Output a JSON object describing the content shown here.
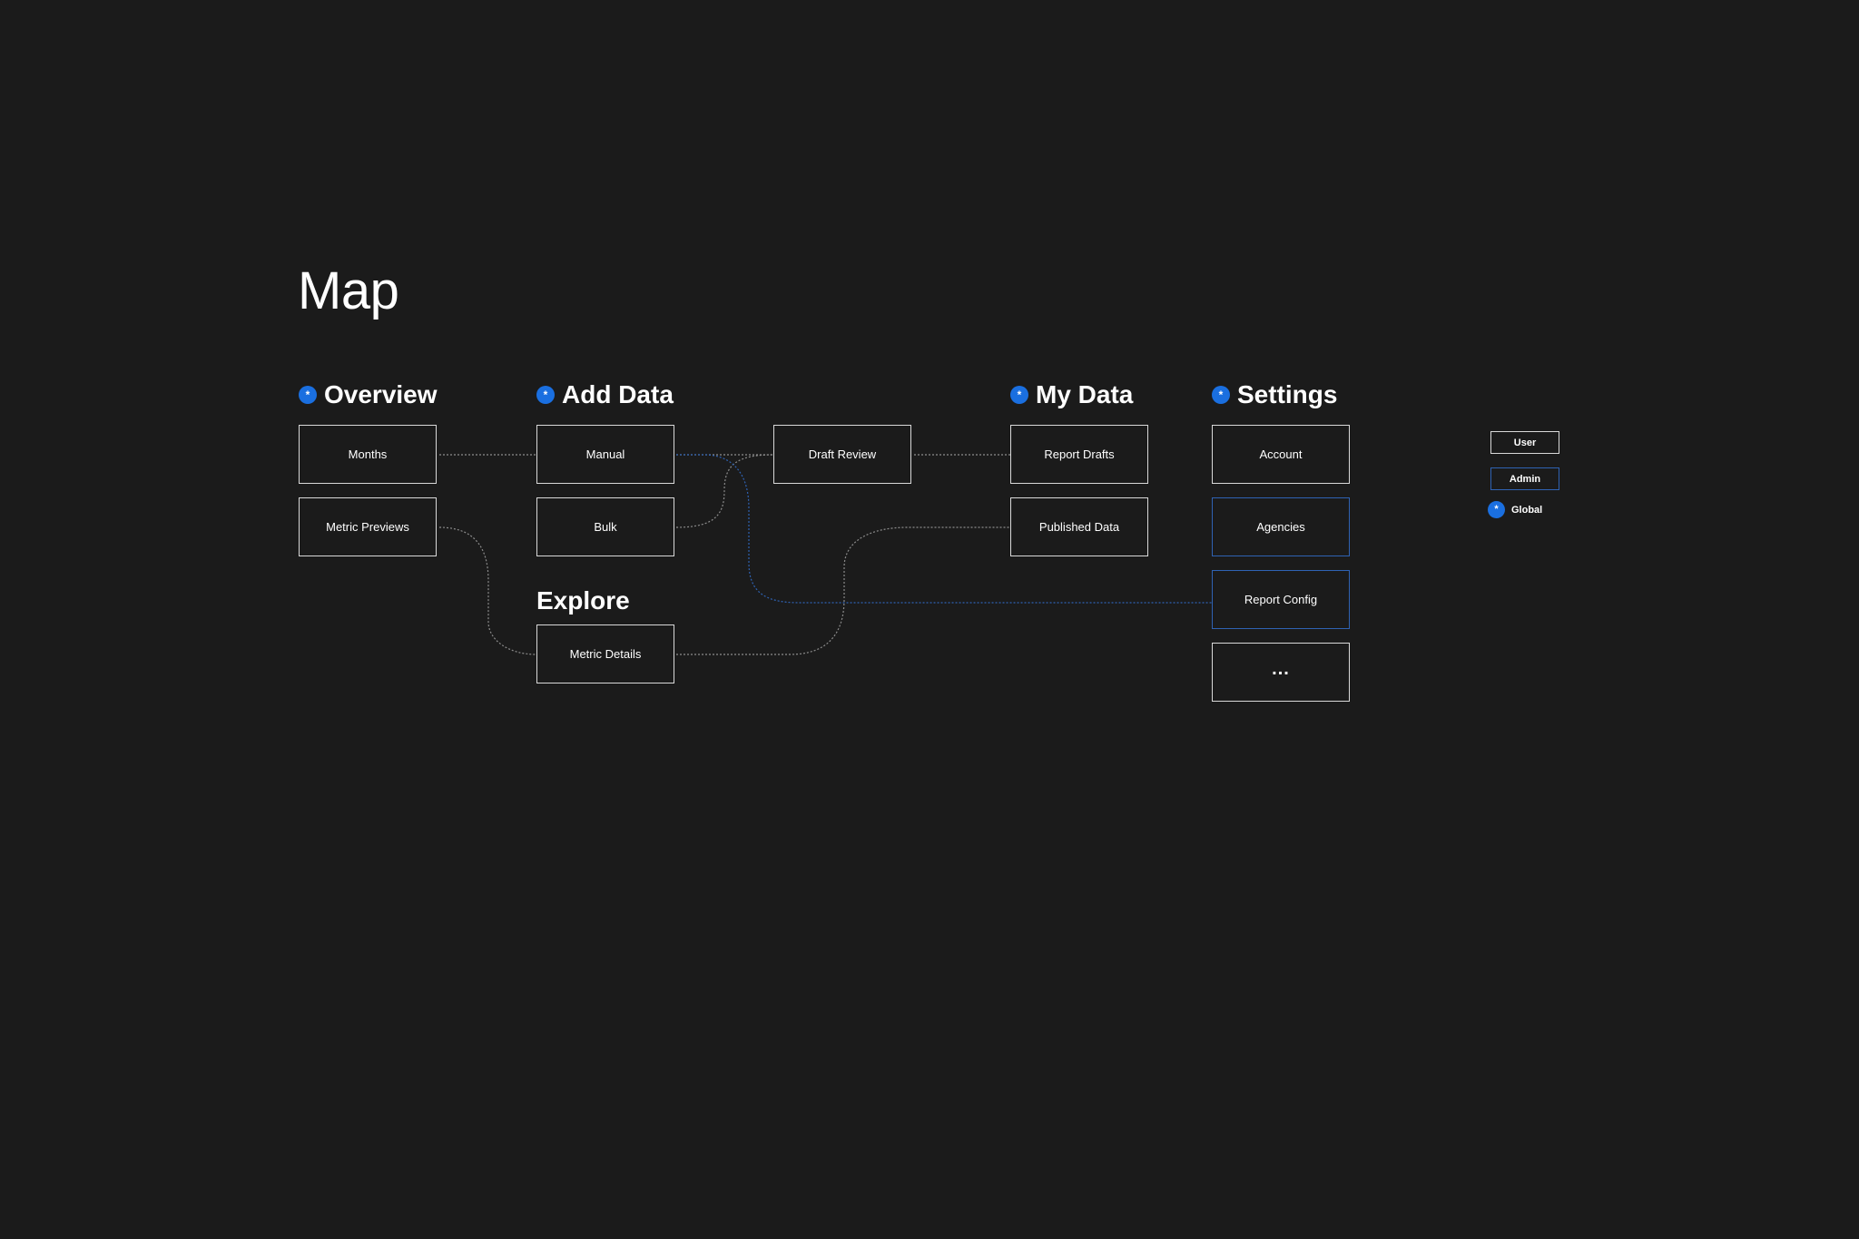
{
  "title": "Map",
  "global_marker": "*",
  "sections": {
    "overview": {
      "label": "Overview",
      "global": true
    },
    "add_data": {
      "label": "Add Data",
      "global": true
    },
    "my_data": {
      "label": "My Data",
      "global": true
    },
    "settings": {
      "label": "Settings",
      "global": true
    },
    "explore": {
      "label": "Explore",
      "global": false
    }
  },
  "nodes": {
    "months": {
      "label": "Months",
      "role": "user"
    },
    "metric_previews": {
      "label": "Metric Previews",
      "role": "user"
    },
    "manual": {
      "label": "Manual",
      "role": "user"
    },
    "bulk": {
      "label": "Bulk",
      "role": "user"
    },
    "metric_details": {
      "label": "Metric Details",
      "role": "user"
    },
    "draft_review": {
      "label": "Draft Review",
      "role": "user"
    },
    "report_drafts": {
      "label": "Report Drafts",
      "role": "user"
    },
    "published_data": {
      "label": "Published Data",
      "role": "user"
    },
    "account": {
      "label": "Account",
      "role": "user"
    },
    "agencies": {
      "label": "Agencies",
      "role": "admin"
    },
    "report_config": {
      "label": "Report Config",
      "role": "admin"
    },
    "more": {
      "label": "...",
      "role": "user"
    }
  },
  "links": [
    {
      "from": "Months",
      "to": "Manual",
      "style": "user"
    },
    {
      "from": "Manual",
      "to": "Draft Review",
      "style": "user"
    },
    {
      "from": "Bulk",
      "to": "Draft Review",
      "style": "user"
    },
    {
      "from": "Draft Review",
      "to": "Report Drafts",
      "style": "user"
    },
    {
      "from": "Metric Previews",
      "to": "Metric Details",
      "style": "user"
    },
    {
      "from": "Metric Details",
      "to": "Published Data",
      "style": "user"
    },
    {
      "from": "Manual",
      "to": "Report Config",
      "style": "admin"
    }
  ],
  "legend": {
    "user": "User",
    "admin": "Admin",
    "global": "Global"
  },
  "colors": {
    "background": "#1b1b1b",
    "user_border": "#d9d9d9",
    "admin_border": "#2f62b3",
    "global_dot": "#1a6fe0"
  }
}
